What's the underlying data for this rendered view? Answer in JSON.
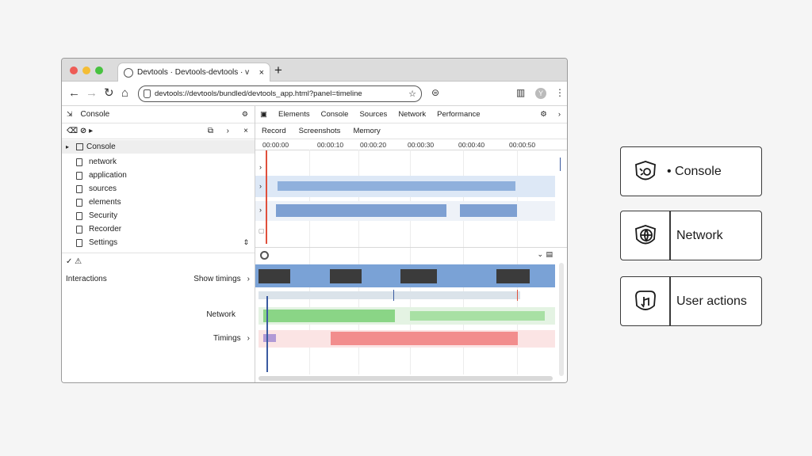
{
  "browser": {
    "tab_title": "Devtools · Devtools-devtools · v",
    "tab_close": "×",
    "new_tab": "+",
    "url": "devtools://devtools/bundled/devtools_app.html?panel=timeline",
    "nav": {
      "back": "←",
      "forward": "→",
      "reload": "↻",
      "home": "⌂"
    }
  },
  "devtools": {
    "top_tabs": [
      "Elements",
      "Console",
      "Sources",
      "Network",
      "Performance",
      "Memory"
    ],
    "left_header": "Console",
    "left_toolbar": "⌫ ⊘ ▸",
    "tree": {
      "root": "Console",
      "items": [
        "network",
        "application",
        "sources",
        "elements",
        "Security",
        "Recorder",
        "Settings"
      ]
    },
    "filter_label": "✓ ⚠",
    "group_rows": [
      {
        "label": "Interactions",
        "value": "Show timings"
      },
      {
        "label": "Network",
        "value": ""
      },
      {
        "label": "Timings",
        "value": ""
      }
    ],
    "right_toolbar": [
      "Record",
      "Screenshots",
      "Memory"
    ],
    "ruler_labels": [
      "00:00:00",
      "00:00:10",
      "00:00:20",
      "00:00:30",
      "00:00:40",
      "00:00:50"
    ]
  },
  "legend": [
    {
      "label": "• Console",
      "icon": "bug-icon"
    },
    {
      "label": "Network",
      "icon": "network-globe-icon"
    },
    {
      "label": "User actions",
      "icon": "user-action-icon"
    }
  ],
  "colors": {
    "blue": "#7aa2d6",
    "light_blue": "#c6d9f1",
    "green": "#7fd07a",
    "light_green": "#cdeccc",
    "red": "#ee7a7a",
    "light_red": "#f6cbcb",
    "playhead": "#e0503c",
    "cursor": "#3a5aa0"
  }
}
